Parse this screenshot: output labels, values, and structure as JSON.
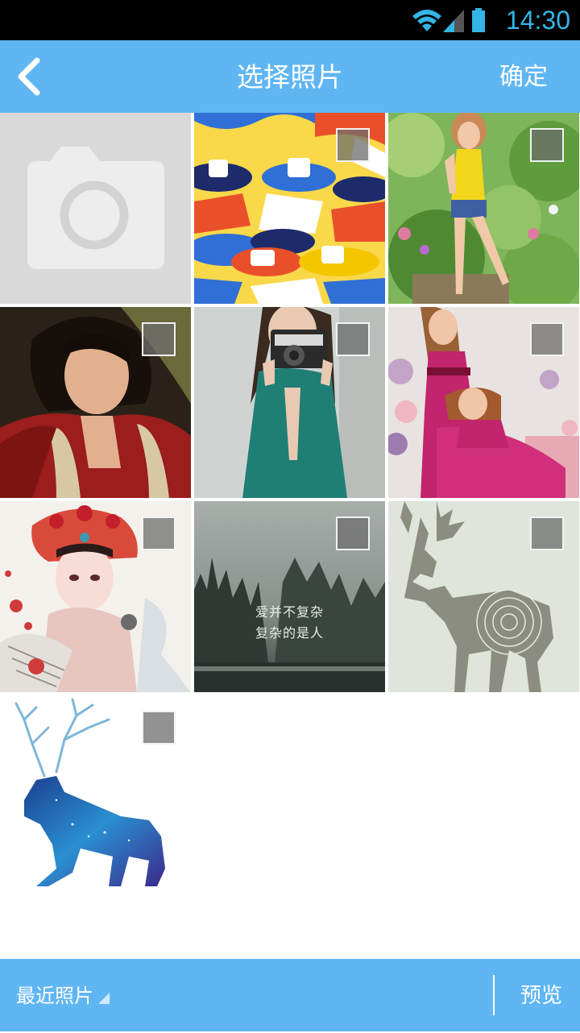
{
  "status_bar": {
    "time": "14:30",
    "icons": [
      "wifi-icon",
      "signal-icon",
      "battery-icon"
    ]
  },
  "header": {
    "back_icon": "chevron-left-icon",
    "title": "选择照片",
    "confirm_label": "确定"
  },
  "grid": {
    "camera_tile_icon": "camera-icon",
    "photos": [
      {
        "subject": "hats-illustration",
        "selected": false
      },
      {
        "subject": "girl-yellow-top-garden",
        "selected": false
      },
      {
        "subject": "woman-red-robe",
        "selected": false
      },
      {
        "subject": "girl-with-camera",
        "selected": false
      },
      {
        "subject": "two-women-pink-dresses",
        "selected": false
      },
      {
        "subject": "opera-girl-painting",
        "selected": false
      },
      {
        "subject": "misty-forest-lake",
        "selected": false,
        "caption_lines": [
          "爱并不复杂",
          "复杂的是人"
        ]
      },
      {
        "subject": "deer-tree-rings",
        "selected": false
      },
      {
        "subject": "galaxy-deer-watercolor",
        "selected": false
      }
    ]
  },
  "bottom_bar": {
    "album_label": "最近照片",
    "preview_label": "预览"
  },
  "colors": {
    "accent": "#5fb6f2",
    "status_bar": "#000000",
    "time_text": "#33b5e5"
  }
}
